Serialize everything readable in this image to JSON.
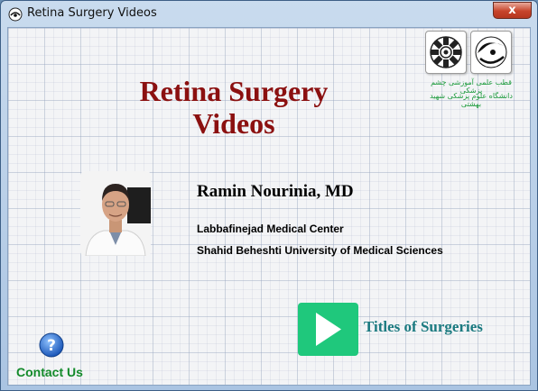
{
  "window": {
    "title": "Retina Surgery Videos",
    "close_label": "x"
  },
  "main": {
    "title_line1": "Retina Surgery",
    "title_line2": "Videos"
  },
  "logos": {
    "persian_line1": "قطب علمی آموزشی چشم پزشکی",
    "persian_line2": "دانشگاه علوم پزشکی شهید بهشتی"
  },
  "doctor": {
    "name": "Ramin Nourinia, MD",
    "center": "Labbafinejad Medical Center",
    "university": "Shahid Beheshti University of Medical Sciences"
  },
  "actions": {
    "titles_label": "Titles of Surgeries",
    "contact_label": "Contact Us"
  },
  "colors": {
    "title": "#8b1010",
    "play_button": "#1fc87c",
    "titles_link": "#1b7a80",
    "contact_link": "#138a2a"
  }
}
